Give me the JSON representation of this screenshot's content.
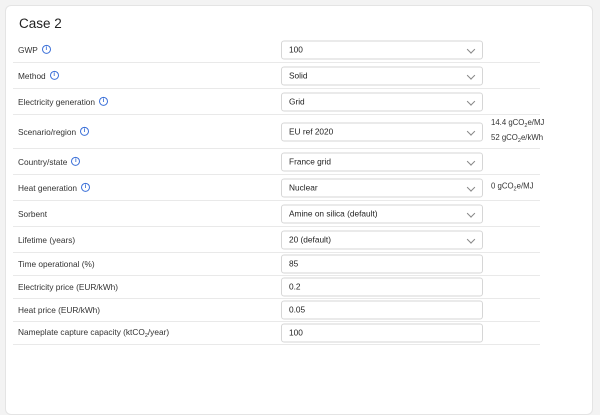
{
  "title": "Case 2",
  "rows": [
    {
      "label": "GWP",
      "info": true,
      "type": "select",
      "value": "100"
    },
    {
      "label": "Method",
      "info": true,
      "type": "select",
      "value": "Solid"
    },
    {
      "label": "Electricity generation",
      "info": true,
      "type": "select",
      "value": "Grid"
    },
    {
      "label": "Scenario/region",
      "info": true,
      "type": "select",
      "value": "EU ref 2020",
      "note_lines": [
        {
          "value": "14.4",
          "unit_prefix": " gCO",
          "sub": "2",
          "unit_suffix": "e/MJ"
        },
        {
          "value": "52",
          "unit_prefix": " gCO",
          "sub": "2",
          "unit_suffix": "e/kWh"
        }
      ]
    },
    {
      "label": "Country/state",
      "info": true,
      "type": "select",
      "value": "France grid"
    },
    {
      "label": "Heat generation",
      "info": true,
      "type": "select",
      "value": "Nuclear",
      "note_lines": [
        {
          "value": "0",
          "unit_prefix": " gCO",
          "sub": "2",
          "unit_suffix": "e/MJ"
        }
      ]
    },
    {
      "label": "Sorbent",
      "info": false,
      "type": "select",
      "value": "Amine on silica (default)"
    },
    {
      "label": "Lifetime (years)",
      "info": false,
      "type": "select",
      "value": "20 (default)"
    },
    {
      "label": "Time operational (%)",
      "info": false,
      "type": "input",
      "value": "85"
    },
    {
      "label": "Electricity price (EUR/kWh)",
      "info": false,
      "type": "input",
      "value": "0.2"
    },
    {
      "label": "Heat price (EUR/kWh)",
      "info": false,
      "type": "input",
      "value": "0.05"
    },
    {
      "label_prefix": "Nameplate capture capacity (ktCO",
      "label_sub": "2",
      "label_suffix": "/year)",
      "info": false,
      "type": "input",
      "value": "100"
    }
  ],
  "colors": {
    "accent": "#3a6fd8",
    "border": "#d6d6d6",
    "background": "#f3f3f3"
  },
  "icons": {
    "info": "info-circle-icon",
    "select": "chevron-down-icon"
  }
}
